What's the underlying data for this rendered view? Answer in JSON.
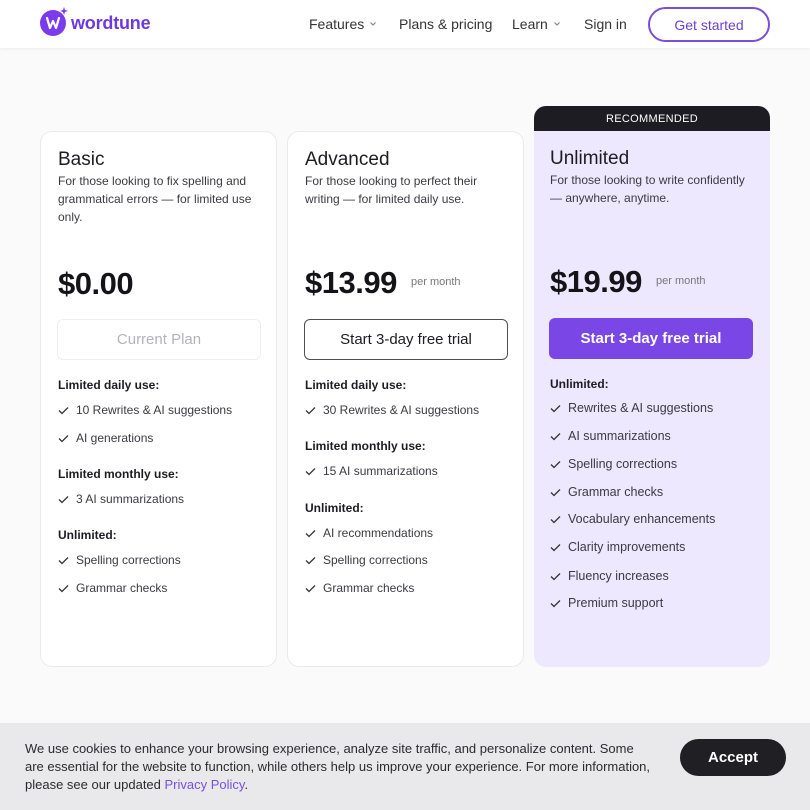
{
  "brand": {
    "name": "wordtune",
    "color": "#7c3aed"
  },
  "nav": {
    "features": "Features",
    "plans": "Plans & pricing",
    "learn": "Learn",
    "signin": "Sign in",
    "get_started": "Get started"
  },
  "plans": {
    "basic": {
      "name": "Basic",
      "desc": "For those looking to fix spelling and grammatical errors — for limited use only.",
      "price": "$0.00",
      "button": "Current Plan",
      "sections": [
        {
          "title": "Limited daily use:",
          "items": [
            "10 Rewrites & AI suggestions",
            "AI generations"
          ]
        },
        {
          "title": "Limited monthly use:",
          "items": [
            "3 AI summarizations"
          ]
        },
        {
          "title": "Unlimited:",
          "items": [
            "Spelling corrections",
            "Grammar checks"
          ]
        }
      ]
    },
    "advanced": {
      "name": "Advanced",
      "desc": "For those looking to perfect their writing — for limited daily use.",
      "price": "$13.99",
      "per": "per month",
      "button": "Start 3-day free trial",
      "sections": [
        {
          "title": "Limited daily use:",
          "items": [
            "30 Rewrites & AI suggestions"
          ]
        },
        {
          "title": "Limited monthly use:",
          "items": [
            "15 AI summarizations"
          ]
        },
        {
          "title": "Unlimited:",
          "items": [
            "AI recommendations",
            "Spelling corrections",
            "Grammar checks"
          ]
        }
      ]
    },
    "unlimited": {
      "banner": "RECOMMENDED",
      "name": "Unlimited",
      "desc": "For those looking to write confidently — anywhere, anytime.",
      "price": "$19.99",
      "per": "per month",
      "button": "Start 3-day free trial",
      "sections": [
        {
          "title": "Unlimited:",
          "items": [
            "Rewrites & AI suggestions",
            "AI summarizations",
            "Spelling corrections",
            "Grammar checks",
            "Vocabulary enhancements",
            "Clarity improvements",
            "Fluency increases",
            "Premium support"
          ]
        }
      ]
    }
  },
  "cookie": {
    "text": "We use cookies to enhance your browsing experience, analyze site traffic, and personalize content. Some are essential for the website to function, while others help us improve your experience. For more information, please see our updated ",
    "link": "Privacy Policy",
    "end": ".",
    "accept": "Accept"
  },
  "icons": {
    "check": "check-icon",
    "chevron": "chevron-down-icon"
  }
}
